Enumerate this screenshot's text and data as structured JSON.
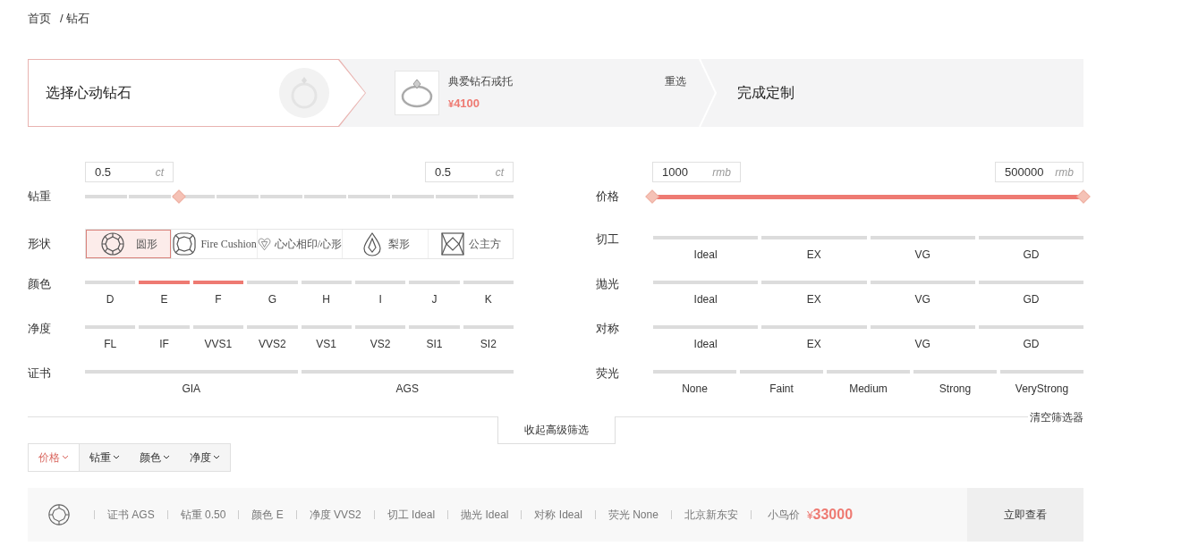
{
  "breadcrumb": [
    {
      "label": "首页"
    },
    {
      "label": "/ 钻石"
    }
  ],
  "steps": {
    "current": {
      "label": "选择心动钻石"
    },
    "product": {
      "name": "典爱钻石戒托",
      "currency": "¥",
      "amount": "4100",
      "action": "重选"
    },
    "next": {
      "label": "完成定制"
    }
  },
  "filters_left": {
    "weight": {
      "label": "钻重",
      "min": {
        "value": "0.5",
        "unit": "ct"
      },
      "max": {
        "value": "0.5",
        "unit": "ct"
      },
      "thumb": {
        "level": 0.22
      }
    },
    "shape": {
      "label": "形状",
      "options": [
        {
          "label": "圆形",
          "kind": "round",
          "selected": true
        },
        {
          "label": "Fire Cushion",
          "kind": "cushion",
          "selected": false
        },
        {
          "label": "心心相印/心形",
          "kind": "heart",
          "selected": false
        },
        {
          "label": "梨形",
          "kind": "pear",
          "selected": false
        },
        {
          "label": "公主方",
          "kind": "princess",
          "selected": false
        }
      ]
    },
    "rows": [
      {
        "label": "颜色",
        "options": [
          {
            "label": "D",
            "selected": false
          },
          {
            "label": "E",
            "selected": true
          },
          {
            "label": "F",
            "selected": true
          },
          {
            "label": "G",
            "selected": false
          },
          {
            "label": "H",
            "selected": false
          },
          {
            "label": "I",
            "selected": false
          },
          {
            "label": "J",
            "selected": false
          },
          {
            "label": "K",
            "selected": false
          }
        ]
      },
      {
        "label": "净度",
        "options": [
          {
            "label": "FL",
            "selected": false
          },
          {
            "label": "IF",
            "selected": false
          },
          {
            "label": "VVS1",
            "selected": false
          },
          {
            "label": "VVS2",
            "selected": false
          },
          {
            "label": "VS1",
            "selected": false
          },
          {
            "label": "VS2",
            "selected": false
          },
          {
            "label": "SI1",
            "selected": false
          },
          {
            "label": "SI2",
            "selected": false
          }
        ]
      },
      {
        "label": "证书",
        "options": [
          {
            "label": "GIA",
            "selected": false
          },
          {
            "label": "AGS",
            "selected": false
          }
        ]
      }
    ]
  },
  "filters_right": {
    "price": {
      "label": "价格",
      "min": {
        "value": "1000",
        "unit": "rmb"
      },
      "max": {
        "value": "500000",
        "unit": "rmb"
      },
      "min_thumb": {
        "level": 0
      },
      "max_thumb": {
        "level": 1
      }
    },
    "rows": [
      {
        "label": "切工",
        "options": [
          {
            "label": "Ideal",
            "selected": false
          },
          {
            "label": "EX",
            "selected": false
          },
          {
            "label": "VG",
            "selected": false
          },
          {
            "label": "GD",
            "selected": false
          }
        ]
      },
      {
        "label": "抛光",
        "options": [
          {
            "label": "Ideal",
            "selected": false
          },
          {
            "label": "EX",
            "selected": false
          },
          {
            "label": "VG",
            "selected": false
          },
          {
            "label": "GD",
            "selected": false
          }
        ]
      },
      {
        "label": "对称",
        "options": [
          {
            "label": "Ideal",
            "selected": false
          },
          {
            "label": "EX",
            "selected": false
          },
          {
            "label": "VG",
            "selected": false
          },
          {
            "label": "GD",
            "selected": false
          }
        ]
      },
      {
        "label": "荧光",
        "options": [
          {
            "label": "None",
            "selected": false
          },
          {
            "label": "Faint",
            "selected": false
          },
          {
            "label": "Medium",
            "selected": false
          },
          {
            "label": "Strong",
            "selected": false
          },
          {
            "label": "VeryStrong",
            "selected": false
          }
        ]
      }
    ]
  },
  "collapse_button": "收起高级筛选",
  "clear_button": "清空筛选器",
  "sort_tabs": [
    {
      "label": "价格",
      "selected": true
    },
    {
      "label": "钻重",
      "selected": false
    },
    {
      "label": "颜色",
      "selected": false
    },
    {
      "label": "净度",
      "selected": false
    }
  ],
  "result": {
    "specs": [
      "证书 AGS",
      "钻重 0.50",
      "颜色 E",
      "净度 VVS2",
      "切工 Ideal",
      "抛光 Ideal",
      "对称 Ideal",
      "荧光 None",
      "北京新东安"
    ],
    "price_label": "小鸟价",
    "currency": "¥",
    "amount": "33000",
    "button": "立即查看"
  }
}
